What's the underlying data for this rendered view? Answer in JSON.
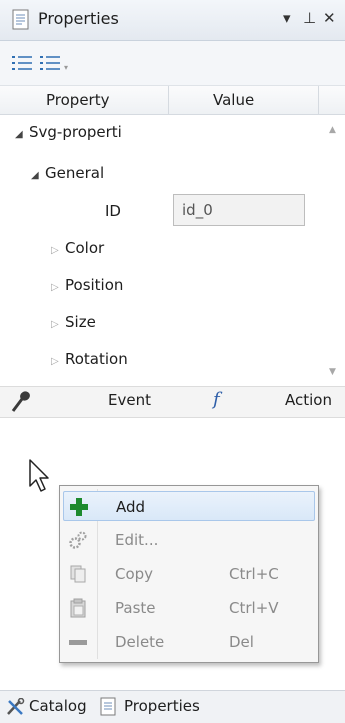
{
  "panel": {
    "title": "Properties",
    "icon": "document-icon",
    "pin_glyph": "▾",
    "pushpin_glyph": "⊥",
    "close_glyph": "✕"
  },
  "toolbar": {
    "categorized_icon": "categorized-list-icon",
    "alphabetical_icon": "alphabetical-list-icon"
  },
  "grid": {
    "header_property": "Property",
    "header_value": "Value",
    "rows": [
      {
        "label": "Svg-properti",
        "expander": "◢"
      },
      {
        "label": "General",
        "expander": "◢"
      },
      {
        "label": "ID",
        "value": "id_0"
      },
      {
        "label": "Color",
        "expander": "▷"
      },
      {
        "label": "Position",
        "expander": "▷"
      },
      {
        "label": "Size",
        "expander": "▷"
      },
      {
        "label": "Rotation",
        "expander": "▷"
      }
    ],
    "scroll_up": "▲",
    "scroll_down": "▼"
  },
  "events": {
    "event_label": "Event",
    "fx_glyph": "f",
    "action_label": "Action"
  },
  "context_menu": {
    "items": [
      {
        "label": "Add",
        "shortcut": "",
        "icon": "plus-icon",
        "enabled": true
      },
      {
        "label": "Edit...",
        "shortcut": "",
        "icon": "gears-icon",
        "enabled": false
      },
      {
        "label": "Copy",
        "shortcut": "Ctrl+C",
        "icon": "copy-icon",
        "enabled": false
      },
      {
        "label": "Paste",
        "shortcut": "Ctrl+V",
        "icon": "paste-icon",
        "enabled": false
      },
      {
        "label": "Delete",
        "shortcut": "Del",
        "icon": "delete-icon",
        "enabled": false
      }
    ]
  },
  "bottom_tabs": [
    {
      "label": "Catalog",
      "icon": "tools-icon"
    },
    {
      "label": "Properties",
      "icon": "document-icon"
    }
  ],
  "colors": {
    "add_icon_green": "#1d8a2e",
    "highlight_border": "#a9c7ea",
    "fx_blue": "#2e5ea8"
  }
}
